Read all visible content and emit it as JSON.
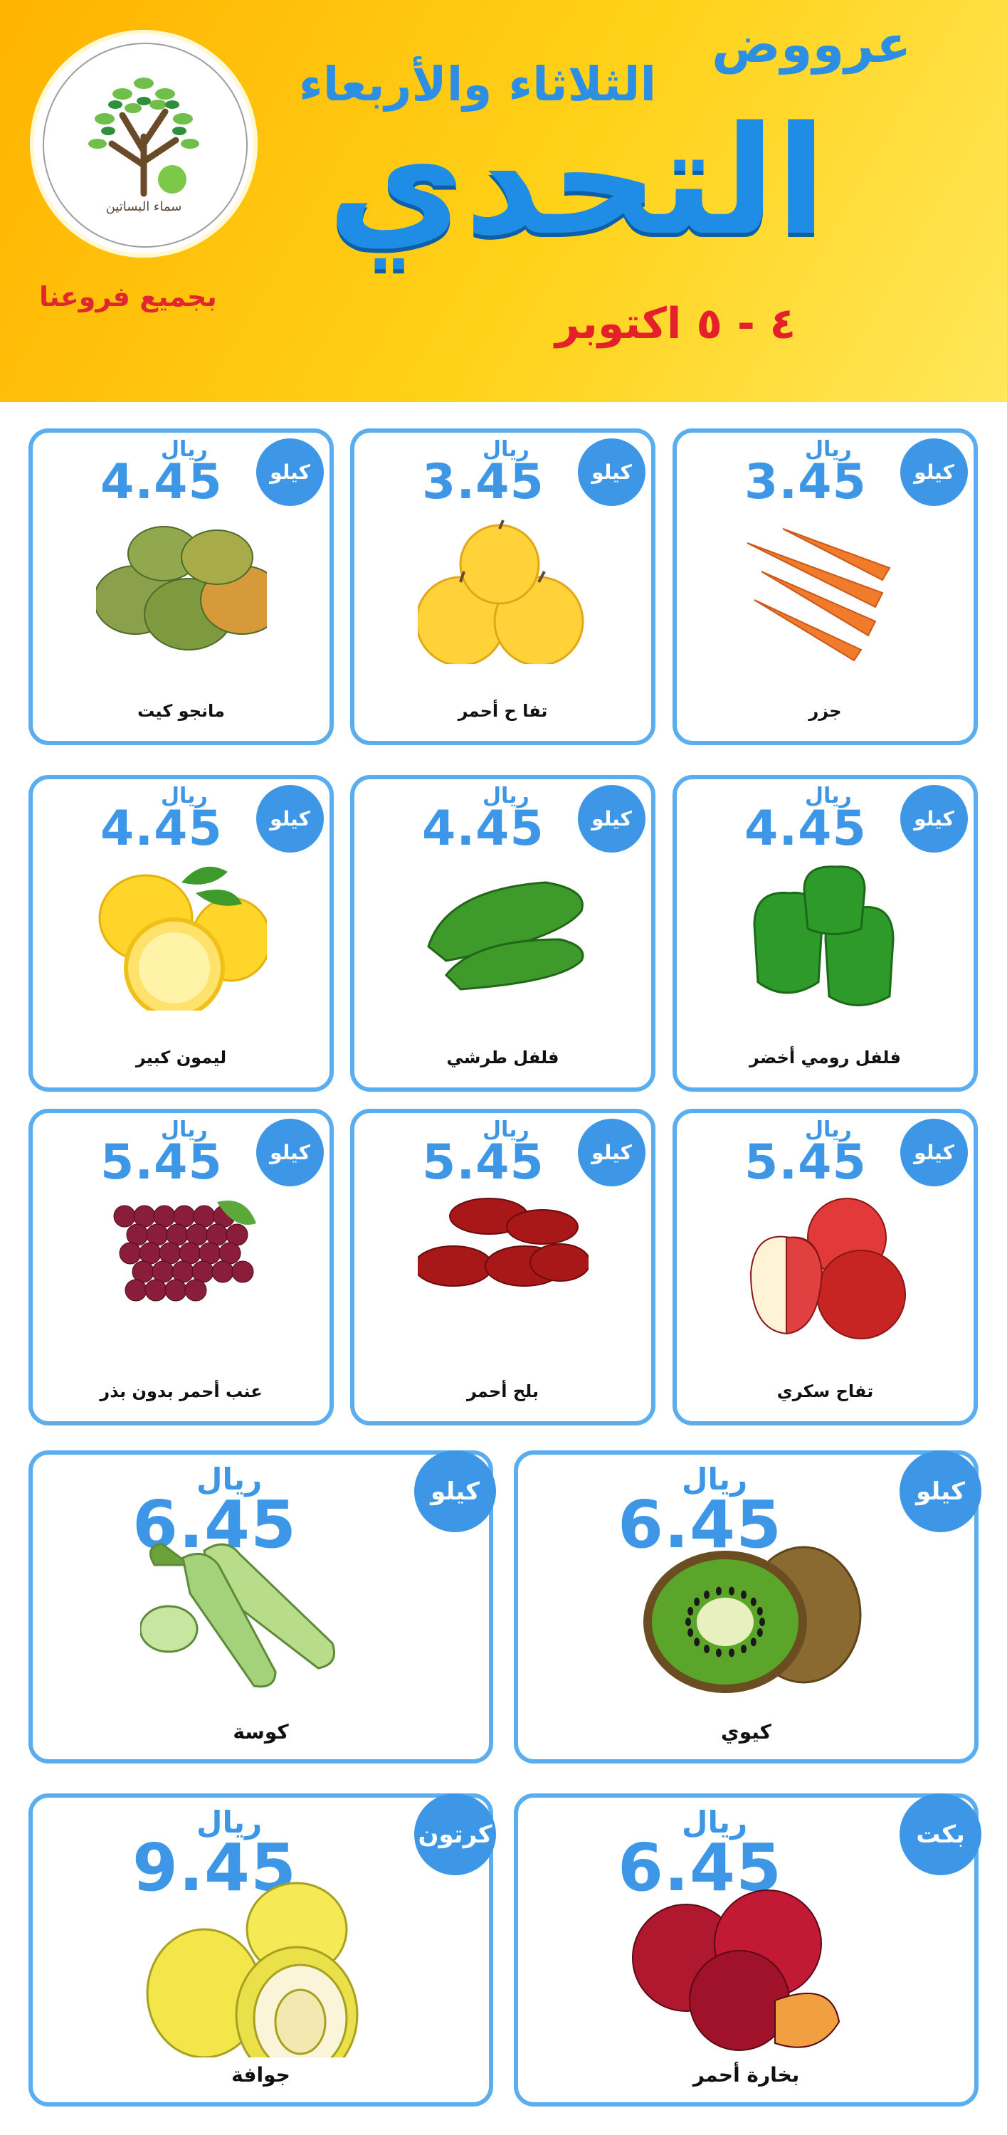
{
  "header": {
    "offers": "عرووض",
    "days": "الثلاثاء والأربعاء",
    "title": "التحدي",
    "date": "٤ - ٥ اكتوبر",
    "branches": "بجميع فروعنا",
    "logo_text": "سماء البساتين"
  },
  "colors": {
    "accent": "#3d97e6",
    "header_bg": "#ffc20e",
    "date": "#e4202a"
  },
  "products": [
    {
      "name": "جزر",
      "unit": "كيلو",
      "currency": "ريال",
      "price": "3.45",
      "icon": "carrots"
    },
    {
      "name": "تفا ح أحمر",
      "unit": "كيلو",
      "currency": "ريال",
      "price": "3.45",
      "icon": "yellow-apples"
    },
    {
      "name": "مانجو كيت",
      "unit": "كيلو",
      "currency": "ريال",
      "price": "4.45",
      "icon": "mangoes"
    },
    {
      "name": "فلفل رومي أخضر",
      "unit": "كيلو",
      "currency": "ريال",
      "price": "4.45",
      "icon": "bell-peppers"
    },
    {
      "name": "فلفل طرشي",
      "unit": "كيلو",
      "currency": "ريال",
      "price": "4.45",
      "icon": "green-chilies"
    },
    {
      "name": "ليمون كبير",
      "unit": "كيلو",
      "currency": "ريال",
      "price": "4.45",
      "icon": "lemons"
    },
    {
      "name": "تفاح سكري",
      "unit": "كيلو",
      "currency": "ريال",
      "price": "5.45",
      "icon": "red-apples"
    },
    {
      "name": "بلح أحمر",
      "unit": "كيلو",
      "currency": "ريال",
      "price": "5.45",
      "icon": "red-dates"
    },
    {
      "name": "عنب أحمر بدون بذر",
      "unit": "كيلو",
      "currency": "ريال",
      "price": "5.45",
      "icon": "red-grapes"
    },
    {
      "name": "كيوي",
      "unit": "كيلو",
      "currency": "ريال",
      "price": "6.45",
      "icon": "kiwi"
    },
    {
      "name": "كوسة",
      "unit": "كيلو",
      "currency": "ريال",
      "price": "6.45",
      "icon": "zucchini"
    },
    {
      "name": "بخارة أحمر",
      "unit": "بكت",
      "currency": "ريال",
      "price": "6.45",
      "icon": "plums"
    },
    {
      "name": "جوافة",
      "unit": "كرتون",
      "currency": "ريال",
      "price": "9.45",
      "icon": "guavas"
    }
  ]
}
